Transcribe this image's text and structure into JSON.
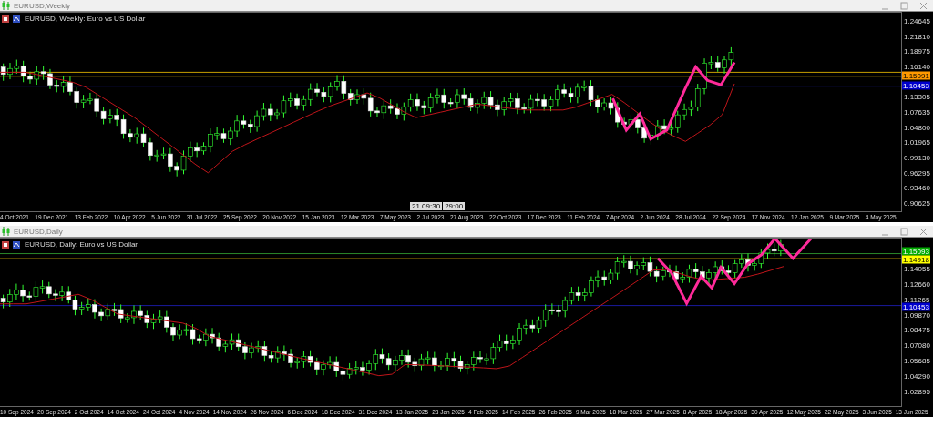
{
  "windows": [
    {
      "title": "EURUSD,Weekly",
      "chart_label": "EURUSD, Weekly:  Euro vs US Dollar",
      "kind": "weekly",
      "price_axis": [
        "1.24645",
        "1.21810",
        "1.18975",
        "1.16140",
        "1.13305",
        "1.07635",
        "1.04800",
        "1.01965",
        "0.99130",
        "0.96295",
        "0.93460",
        "0.90625"
      ],
      "price_tags": [
        {
          "text": "1.15091",
          "color": "#ff9900"
        },
        {
          "text": "1.10453",
          "color": "#0000cc"
        }
      ],
      "crosshair_labels": [
        "21 09:30",
        "29:00"
      ],
      "date_axis": [
        "4 Oct 2021",
        "19 Dec 2021",
        "13 Feb 2022",
        "10 Apr 2022",
        "5 Jun 2022",
        "31 Jul 2022",
        "25 Sep 2022",
        "20 Nov 2022",
        "15 Jan 2023",
        "12 Mar 2023",
        "7 May 2023",
        "2 Jul 2023",
        "27 Aug 2023",
        "22 Oct 2023",
        "17 Dec 2023",
        "11 Feb 2024",
        "7 Apr 2024",
        "2 Jun 2024",
        "28 Jul 2024",
        "22 Sep 2024",
        "17 Nov 2024",
        "12 Jan 2025",
        "9 Mar 2025",
        "4 May 2025"
      ]
    },
    {
      "title": "EURUSD,Daily",
      "chart_label": "EURUSD, Daily:  Euro vs US Dollar",
      "kind": "daily",
      "price_axis": [
        "1.14055",
        "1.12660",
        "1.11265",
        "1.09870",
        "1.08475",
        "1.07080",
        "1.05685",
        "1.04290",
        "1.02895"
      ],
      "price_tags": [
        {
          "text": "1.15093",
          "color": "#00aa00"
        },
        {
          "text": "1.14918",
          "color": "#ffff00"
        },
        {
          "text": "1.10453",
          "color": "#0000cc"
        }
      ],
      "date_axis": [
        "10 Sep 2024",
        "20 Sep 2024",
        "2 Oct 2024",
        "14 Oct 2024",
        "24 Oct 2024",
        "4 Nov 2024",
        "14 Nov 2024",
        "26 Nov 2024",
        "6 Dec 2024",
        "18 Dec 2024",
        "31 Dec 2024",
        "13 Jan 2025",
        "23 Jan 2025",
        "4 Feb 2025",
        "14 Feb 2025",
        "26 Feb 2025",
        "9 Mar 2025",
        "18 Mar 2025",
        "27 Mar 2025",
        "8 Apr 2025",
        "18 Apr 2025",
        "30 Apr 2025",
        "12 May 2025",
        "22 May 2025",
        "3 Jun 2025",
        "13 Jun 2025"
      ]
    }
  ]
}
